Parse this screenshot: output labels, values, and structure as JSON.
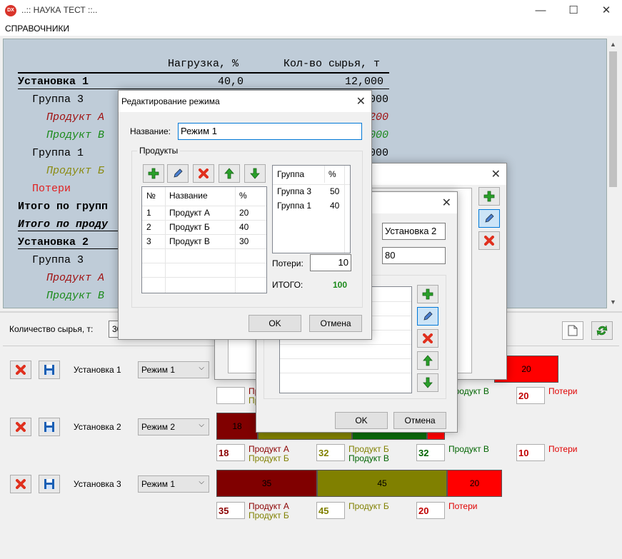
{
  "app": {
    "icon_text": "DX",
    "title": "..:: НАУКА ТЕСТ ::..",
    "minimize": "—",
    "maximize": "☐",
    "close": "✕"
  },
  "menu": {
    "handbooks": "СПРАВОЧНИКИ"
  },
  "report": {
    "header_load": "Нагрузка, %",
    "header_raw": "Кол-во сырья, т",
    "rows": [
      {
        "label": "Установка 1",
        "load": "40,0",
        "raw": "12,000",
        "color": "#000000"
      },
      {
        "label": "Группа 3",
        "raw": "000",
        "color": "#000000"
      },
      {
        "label": "Продукт А",
        "raw": "200",
        "color": "#a01010"
      },
      {
        "label": "Продукт В",
        "raw": "000",
        "color": "#1a8a1a"
      },
      {
        "label": "Группа 1",
        "raw": "000",
        "color": "#000000"
      },
      {
        "label": "Продукт Б",
        "color": "#8a8a10"
      },
      {
        "label": "Потери",
        "color": "#e02020"
      },
      {
        "label": "Итого по групп",
        "color": "#000000"
      },
      {
        "label": "Итого по проду",
        "color": "#000000"
      },
      {
        "label": "Установка 2",
        "color": "#000000"
      },
      {
        "label": "Группа 3",
        "color": "#000000"
      },
      {
        "label": "Продукт А",
        "color": "#a01010"
      },
      {
        "label": "Продукт В",
        "color": "#1a8a1a"
      }
    ]
  },
  "controls": {
    "qty_label": "Количество сырья, т:",
    "qty_value": "30"
  },
  "units": [
    {
      "name": "Установка 1",
      "mode": "Режим 1",
      "segments": [
        {
          "value": "20",
          "color": "#ff0000"
        }
      ],
      "legend": [
        {
          "num": "",
          "items": [
            {
              "text": "Продукт А",
              "color": "#8b0000"
            },
            {
              "text": "Продукт Б",
              "color": "#808000"
            }
          ]
        },
        {
          "num": "",
          "items": [
            {
              "text": "Продукт В",
              "color": "#006400"
            }
          ]
        },
        {
          "num": "20",
          "items": [
            {
              "text": "Потери",
              "color": "#e00000"
            }
          ]
        }
      ]
    },
    {
      "name": "Установка 2",
      "mode": "Режим 2",
      "segments": [
        {
          "value": "18",
          "color": "#800000"
        }
      ],
      "legend": [
        {
          "num": "18",
          "items": [
            {
              "text": "Продукт А",
              "color": "#8b0000"
            },
            {
              "text": "Продукт Б",
              "color": "#808000"
            }
          ]
        },
        {
          "num": "32",
          "items": [
            {
              "text": "Продукт Б",
              "color": "#808000"
            },
            {
              "text": "Продукт В",
              "color": "#006400"
            }
          ]
        },
        {
          "num": "32",
          "items": [
            {
              "text": "Продукт В",
              "color": "#006400"
            }
          ]
        },
        {
          "num": "10",
          "items": [
            {
              "text": "Потери",
              "color": "#e00000"
            }
          ]
        }
      ]
    },
    {
      "name": "Установка 3",
      "mode": "Режим 1",
      "segments": [
        {
          "value": "35",
          "color": "#800000"
        },
        {
          "value": "45",
          "color": "#808000"
        },
        {
          "value": "20",
          "color": "#ff0000"
        }
      ],
      "legend": [
        {
          "num": "35",
          "items": [
            {
              "text": "Продукт А",
              "color": "#8b0000"
            },
            {
              "text": "Продукт Б",
              "color": "#808000"
            }
          ]
        },
        {
          "num": "45",
          "items": [
            {
              "text": "Продукт Б",
              "color": "#808000"
            }
          ]
        },
        {
          "num": "20",
          "items": [
            {
              "text": "Потери",
              "color": "#e00000"
            }
          ]
        }
      ]
    }
  ],
  "dialog_unit": {
    "name_value": "Установка 2",
    "load_value": "80",
    "ok": "OK",
    "cancel": "Отмена"
  },
  "dialog_mode": {
    "title": "Редактирование режима",
    "name_label": "Название:",
    "name_value": "Режим 1",
    "products_group": "Продукты",
    "products_headers": [
      "№",
      "Название",
      "%"
    ],
    "products": [
      {
        "n": "1",
        "name": "Продукт А",
        "pct": "20"
      },
      {
        "n": "2",
        "name": "Продукт Б",
        "pct": "40"
      },
      {
        "n": "3",
        "name": "Продукт В",
        "pct": "30"
      }
    ],
    "groups_headers": [
      "Группа",
      "%"
    ],
    "groups": [
      {
        "name": "Группа 3",
        "pct": "50"
      },
      {
        "name": "Группа 1",
        "pct": "40"
      }
    ],
    "losses_label": "Потери:",
    "losses_value": "10",
    "total_label": "ИТОГО:",
    "total_value": "100",
    "ok": "OK",
    "cancel": "Отмена"
  }
}
